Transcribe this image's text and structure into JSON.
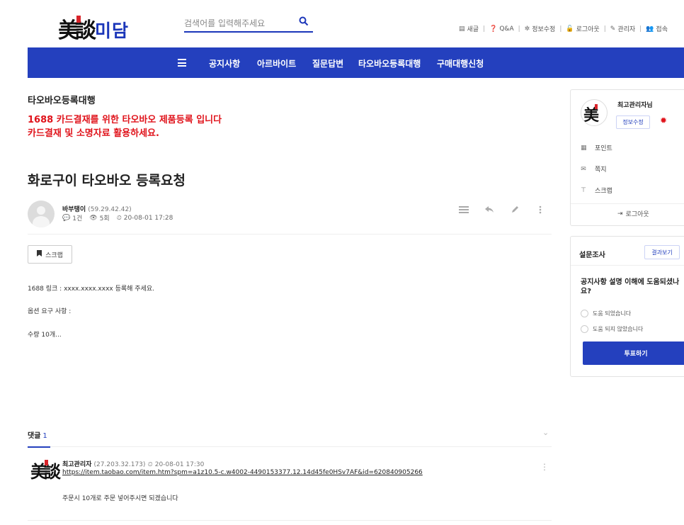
{
  "header": {
    "logo_hanja": "美談",
    "logo_korean": "미담",
    "search_placeholder": "검색어를 입력해주세요",
    "top_links": [
      "새글",
      "Q&A",
      "정보수정",
      "로그아웃",
      "관리자",
      "접속"
    ]
  },
  "nav": {
    "items": [
      "공지사항",
      "아르바이트",
      "질문답변",
      "타오바오등록대행",
      "구매대행신청"
    ]
  },
  "board": {
    "title": "타오바오등록대행",
    "notice_line1": "1688 카드결재를 위한 타오바오 제품등록 입니다",
    "notice_line2": "카드결재 및 소명자료 활용하세요."
  },
  "post": {
    "title": "화로구이 타오바오 등록요청",
    "author": "바부탱이",
    "author_ip": "(59.29.42.42)",
    "comments": "1건",
    "views": "5회",
    "date": "20-08-01 17:28",
    "scrap_label": "스크랩",
    "lines": [
      "1688 링크 : xxxx.xxxx.xxxx 등록해 주세요.",
      "옵션 요구 사항 :",
      "수량 10개..."
    ]
  },
  "comments": {
    "label": "댓글",
    "count": "1",
    "items": [
      {
        "author": "최고관리자",
        "ip": "(27.203.32.173)",
        "date": "20-08-01 17:30",
        "link": "https://item.taobao.com/item.htm?spm=a1z10.5-c.w4002-4490153377.12.14d45fe0HSv7AF&id=620840905266",
        "text": "주문시 10개로 주문 넣어주시면 되겠습니다"
      }
    ]
  },
  "sidebar": {
    "profile": {
      "name": "최고관리자님",
      "edit_label": "정보수정",
      "rows": [
        "포인트",
        "쪽지",
        "스크랩"
      ],
      "logout": "로그아웃"
    },
    "poll": {
      "title": "설문조사",
      "result_label": "결과보기",
      "question": "공지사항 설명 이해에 도움되셨나요?",
      "options": [
        "도움 되었습니다",
        "도움 되지 않았습니다"
      ],
      "vote_label": "투표하기"
    }
  },
  "colors": {
    "brand_blue": "#2440be",
    "notice_red": "#e0131b"
  }
}
